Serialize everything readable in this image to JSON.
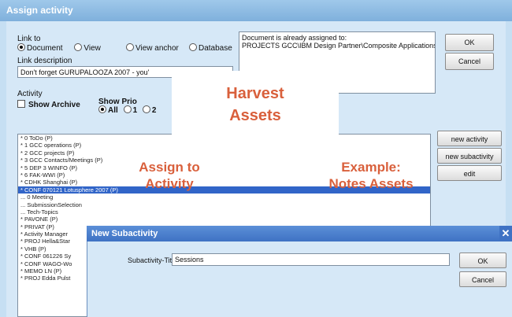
{
  "window": {
    "title": "Assign activity"
  },
  "link": {
    "label": "Link to",
    "options": [
      {
        "label": "Document",
        "checked": true
      },
      {
        "label": "View",
        "checked": false
      },
      {
        "label": "View anchor",
        "checked": false
      },
      {
        "label": "Database",
        "checked": false
      }
    ],
    "description_label": "Link description",
    "description_value": "Don't forget GURUPALOOZA 2007 - you'"
  },
  "assigned": {
    "label": "Document is already assigned to:",
    "value": "PROJECTS GCC\\IBM Design Partner\\Composite Applications"
  },
  "buttons": {
    "ok": "OK",
    "cancel": "Cancel",
    "new_activity": "new activity",
    "new_subactivity": "new subactivity",
    "edit": "edit"
  },
  "activity": {
    "label": "Activity",
    "show_archive": "Show Archive",
    "show_prio": "Show Prio",
    "prio_options": [
      "All",
      "1",
      "2"
    ]
  },
  "list_items": [
    "* 0 ToDo (P)",
    "* 1 GCC operations (P)",
    "* 2 GCC projects (P)",
    "* 3 GCC Contacts/Meetings (P)",
    "* 5 DEP 3 WINFO (P)",
    "* 6 FAK-WWI (P)",
    "* CDHK Shanghai (P)",
    "* CONF 070121 Lotusphere 2007 (P)",
    "... 0 Meeting",
    "... SubmissionSelection",
    "... Tech-Topics",
    "* PAVONE (P)",
    "* PRIVAT (P)",
    "* Activity Manager",
    "* PROJ Hella&Star",
    "* VHB (P)",
    "* CONF 061226 Sy",
    "* CONF WAGO-Wo",
    "* MEMO LN (P)",
    "* PROJ Edda Pulst"
  ],
  "selected_index": 7,
  "overlays": {
    "harvest_line1": "Harvest",
    "harvest_line2": "Assets",
    "assign_line1": "Assign to",
    "assign_line2": "Activity",
    "example_line1": "Example:",
    "example_line2": "Notes Assets"
  },
  "subactivity": {
    "title": "New Subactivity",
    "field_label": "Subactivity-Title",
    "field_value": "Sessions",
    "ok": "OK",
    "cancel": "Cancel"
  },
  "colors": {
    "accent": "#d9603c",
    "selection": "#3165c8"
  }
}
